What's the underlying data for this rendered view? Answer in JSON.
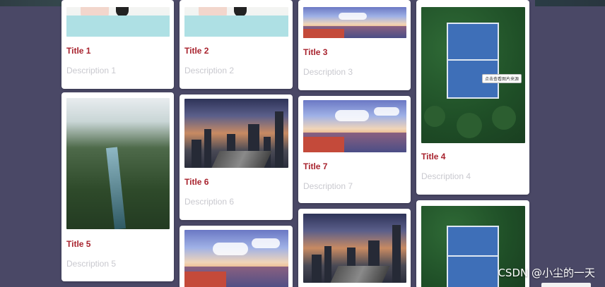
{
  "cards": [
    {
      "title": "Title 1",
      "description": "Description 1"
    },
    {
      "title": "Title 2",
      "description": "Description 2"
    },
    {
      "title": "Title 3",
      "description": "Description 3"
    },
    {
      "title": "Title 4",
      "description": "Description 4"
    },
    {
      "title": "Title 5",
      "description": "Description 5"
    },
    {
      "title": "Title 6",
      "description": "Description 6"
    },
    {
      "title": "Title 7",
      "description": "Description 7"
    }
  ],
  "tooltip": "点击查看图片来源",
  "watermark": "CSDN @小尘的一天",
  "colors": {
    "background": "#4a4866",
    "title": "#a8232e",
    "description": "#c9c9cf",
    "card": "#ffffff"
  }
}
